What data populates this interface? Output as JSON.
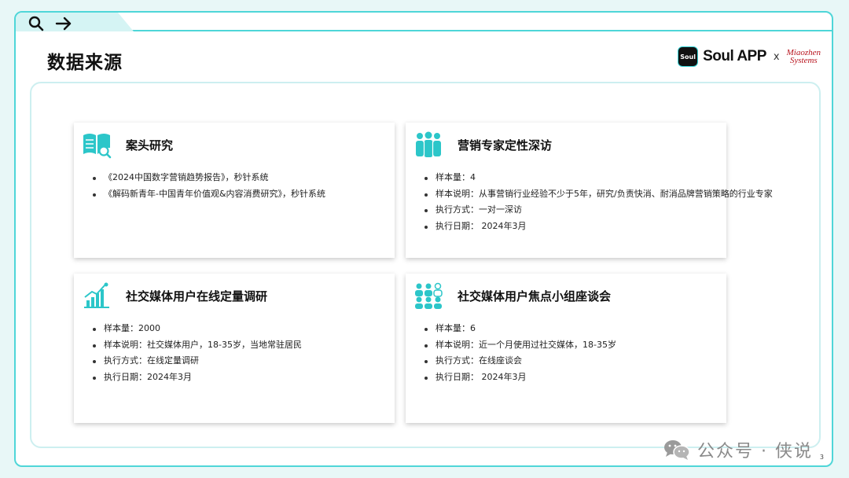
{
  "header": {
    "title": "数据来源",
    "logo": {
      "badge_text": "Soul",
      "app_text": "Soul APP",
      "separator": "x",
      "partner_line1": "Miaozhen",
      "partner_line2": "Systems"
    }
  },
  "nav": {
    "search_icon": "search-icon",
    "forward_icon": "arrow-right-icon"
  },
  "cards": [
    {
      "icon": "book-search-icon",
      "title": "案头研究",
      "items": [
        "《2024中国数字营销趋势报告》，秒针系统",
        "《解码新青年-中国青年价值观&内容消费研究》，秒针系统"
      ]
    },
    {
      "icon": "people-group-icon",
      "title": "营销专家定性深访",
      "items": [
        "样本量：4",
        "样本说明：从事营销行业经验不少于5年，研究/负责快消、耐消品牌营销策略的行业专家",
        "执行方式：一对一深访",
        "执行日期： 2024年3月"
      ]
    },
    {
      "icon": "bar-chart-icon",
      "title": "社交媒体用户在线定量调研",
      "items": [
        "样本量：2000",
        "样本说明：社交媒体用户，18-35岁，当地常驻居民",
        "执行方式：在线定量调研",
        "执行日期：2024年3月"
      ]
    },
    {
      "icon": "focus-group-icon",
      "title": "社交媒体用户焦点小组座谈会",
      "items": [
        "样本量：6",
        "样本说明：近一个月使用过社交媒体，18-35岁",
        "执行方式：在线座谈会",
        "执行日期： 2024年3月"
      ]
    }
  ],
  "watermark": {
    "text": "公众号 · 侠说",
    "icon": "wechat-icon"
  },
  "page_number": "3",
  "colors": {
    "accent": "#4fd6d8",
    "icon": "#2cc6c9",
    "background": "#e8f7f7"
  }
}
